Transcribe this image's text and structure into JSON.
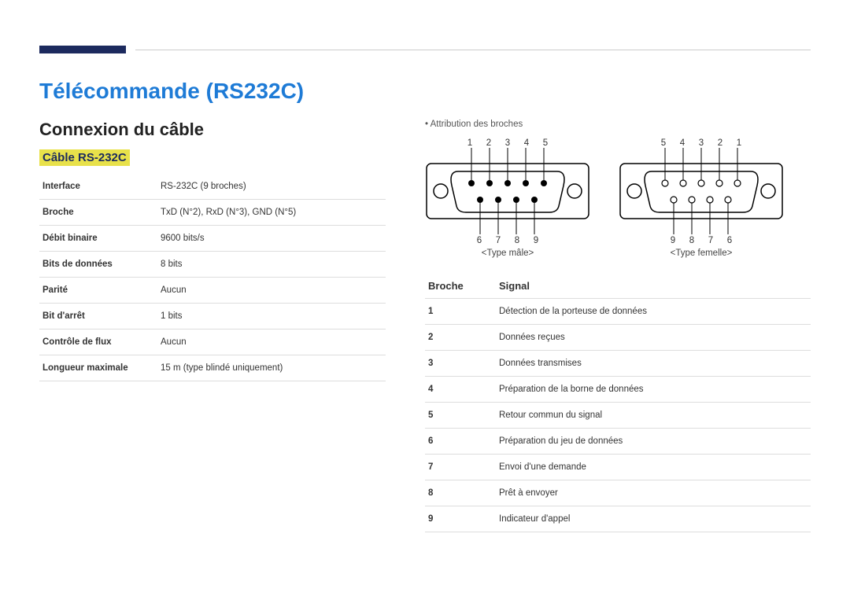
{
  "heading": "Télécommande (RS232C)",
  "subheading": "Connexion du câble",
  "cable_title": "Câble RS-232C",
  "specs": [
    {
      "label": "Interface",
      "value": "RS-232C (9 broches)"
    },
    {
      "label": "Broche",
      "value": "TxD (N°2), RxD (N°3), GND (N°5)"
    },
    {
      "label": "Débit binaire",
      "value": "9600 bits/s"
    },
    {
      "label": "Bits de données",
      "value": "8 bits"
    },
    {
      "label": "Parité",
      "value": "Aucun"
    },
    {
      "label": "Bit d'arrêt",
      "value": "1 bits"
    },
    {
      "label": "Contrôle de flux",
      "value": "Aucun"
    },
    {
      "label": "Longueur maximale",
      "value": "15 m (type blindé uniquement)"
    }
  ],
  "pin_assignment_bullet": "Attribution des broches",
  "connectors": {
    "male": {
      "top_pins": [
        "1",
        "2",
        "3",
        "4",
        "5"
      ],
      "bottom_pins": [
        "6",
        "7",
        "8",
        "9"
      ],
      "label": "<Type mâle>"
    },
    "female": {
      "top_pins": [
        "5",
        "4",
        "3",
        "2",
        "1"
      ],
      "bottom_pins": [
        "9",
        "8",
        "7",
        "6"
      ],
      "label": "<Type femelle>"
    }
  },
  "pin_table": {
    "headers": {
      "pin": "Broche",
      "signal": "Signal"
    },
    "rows": [
      {
        "n": "1",
        "s": "Détection de la porteuse de données"
      },
      {
        "n": "2",
        "s": "Données reçues"
      },
      {
        "n": "3",
        "s": "Données transmises"
      },
      {
        "n": "4",
        "s": "Préparation de la borne de données"
      },
      {
        "n": "5",
        "s": "Retour commun du signal"
      },
      {
        "n": "6",
        "s": "Préparation du jeu de données"
      },
      {
        "n": "7",
        "s": "Envoi d'une demande"
      },
      {
        "n": "8",
        "s": "Prêt à envoyer"
      },
      {
        "n": "9",
        "s": "Indicateur d'appel"
      }
    ]
  }
}
